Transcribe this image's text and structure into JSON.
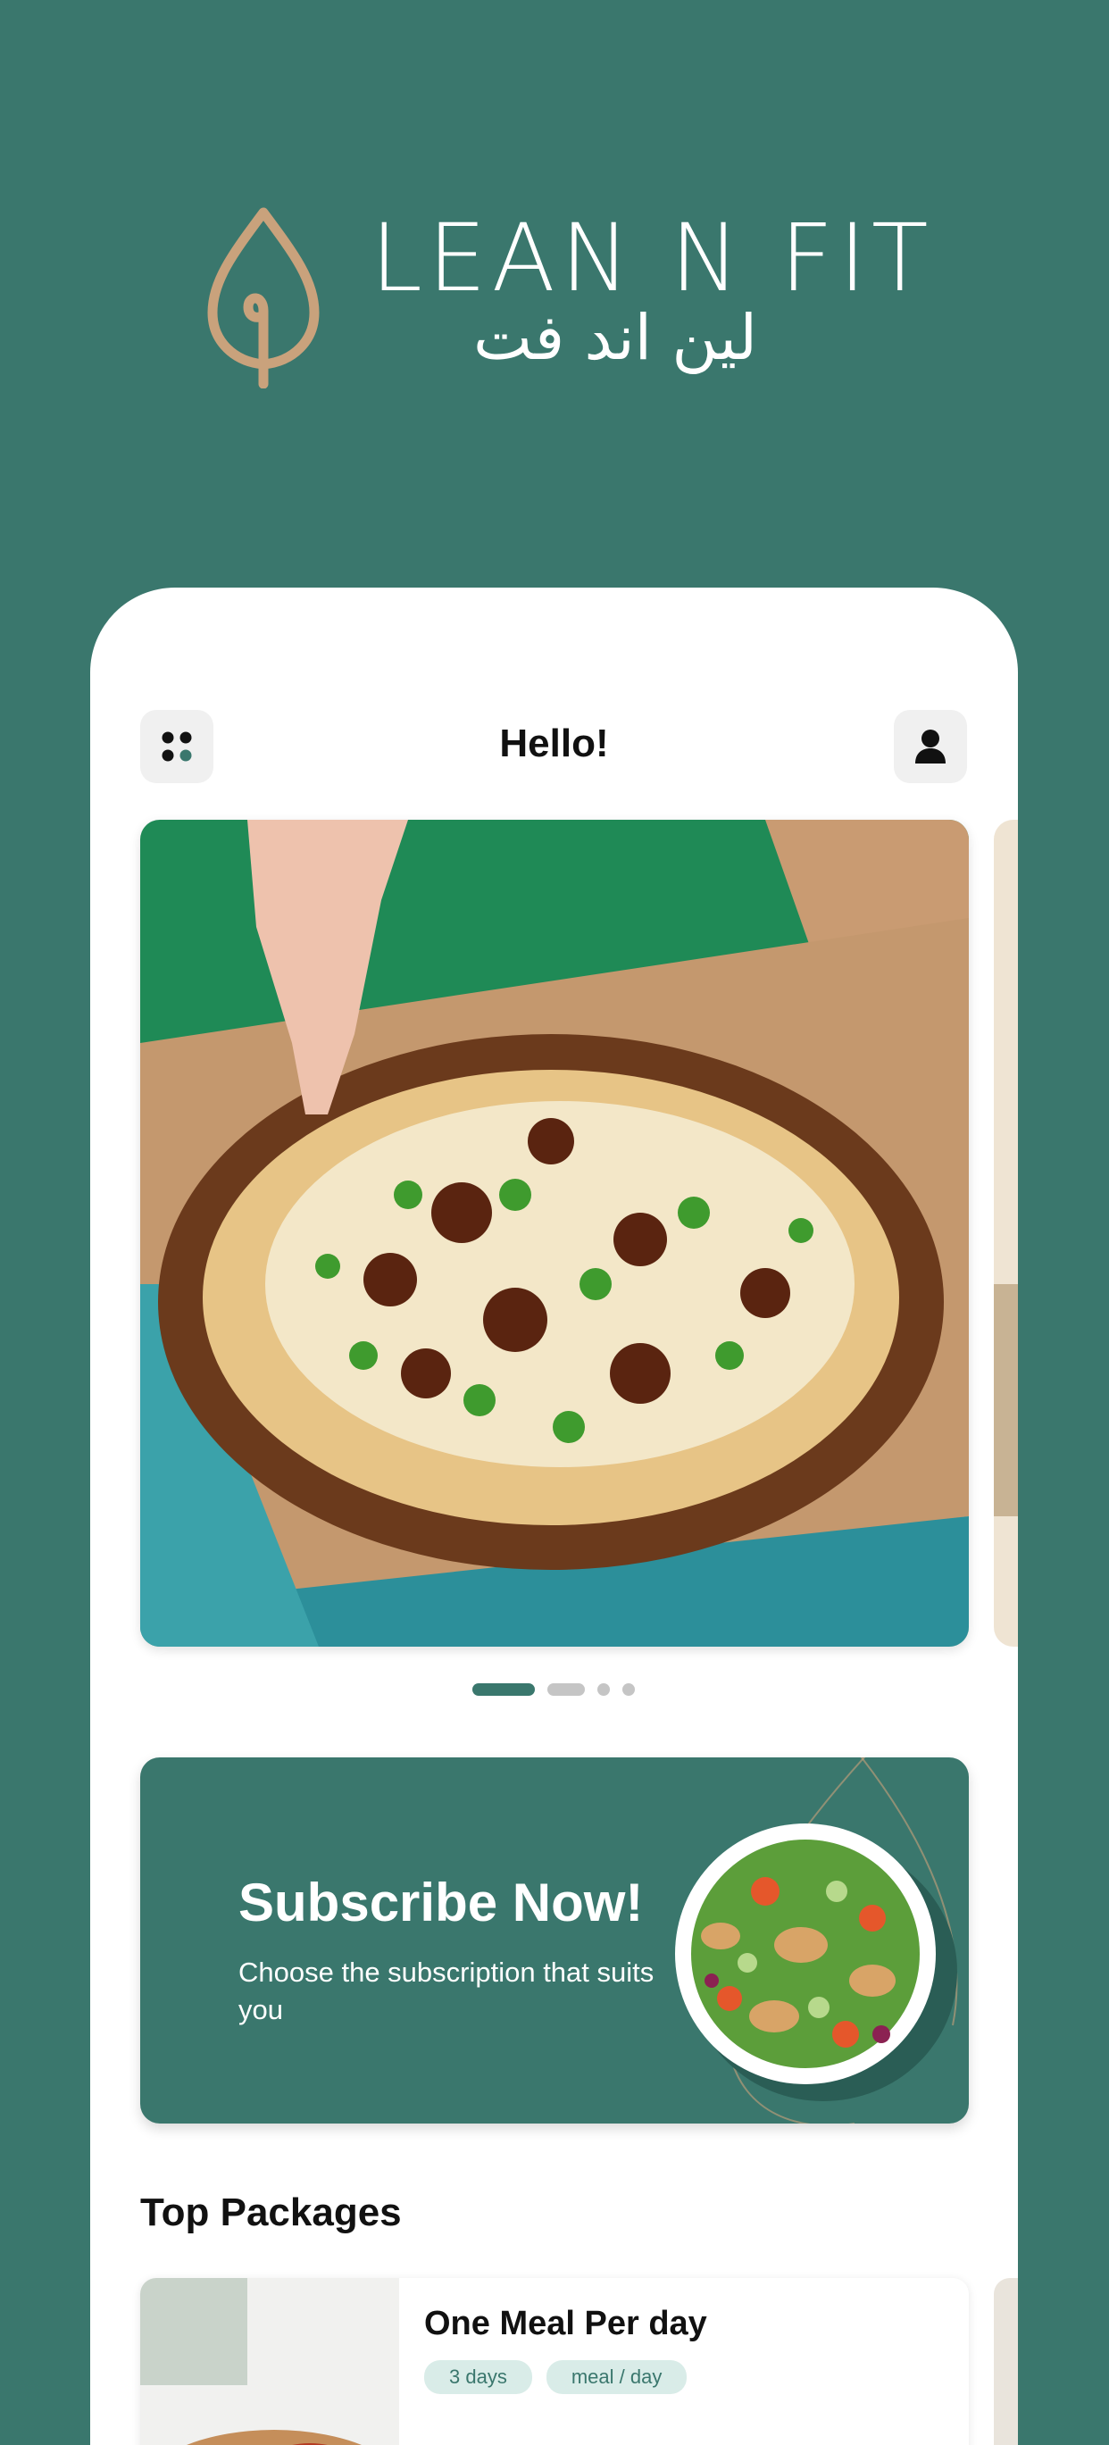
{
  "brand": {
    "name_en": "LEAN N FIT",
    "name_ar": "لين اند فت",
    "colors": {
      "primary": "#3a776d",
      "accent": "#c9a27c"
    }
  },
  "header": {
    "greeting": "Hello!",
    "menu_icon": "grid-dots-icon",
    "profile_icon": "user-icon"
  },
  "carousel": {
    "slides": [
      "pizza-promo",
      "salad-promo"
    ],
    "active_index": 0,
    "dot_count": 4
  },
  "banner": {
    "title": "Subscribe Now!",
    "subtitle": "Choose the subscription that suits you"
  },
  "packages": {
    "section_title": "Top Packages",
    "items": [
      {
        "name": "One Meal Per day",
        "tags": [
          "3 days",
          "meal / day"
        ]
      }
    ]
  }
}
